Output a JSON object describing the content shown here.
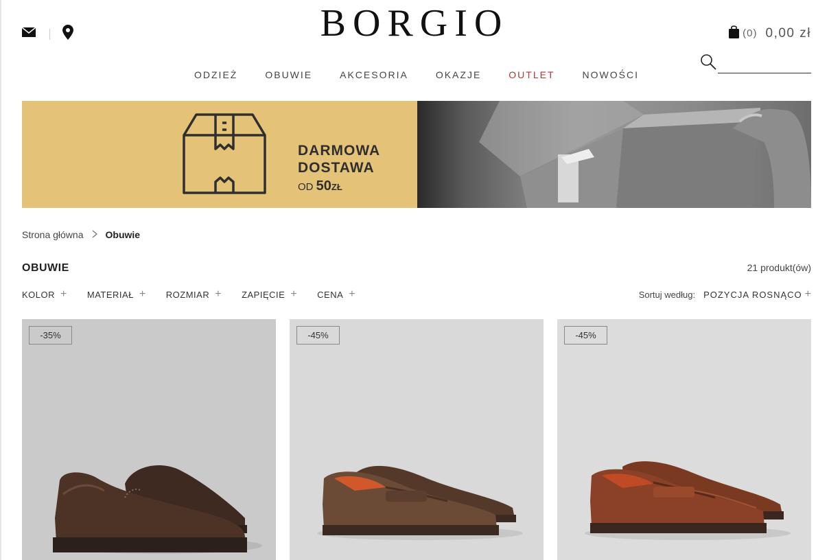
{
  "brand": {
    "logo": "BORGIO"
  },
  "header": {
    "cart_count": "(0)",
    "cart_total": "0,00 zł",
    "search_placeholder": ""
  },
  "nav": {
    "items": [
      {
        "label": "ODZIEŻ"
      },
      {
        "label": "OBUWIE"
      },
      {
        "label": "AKCESORIA"
      },
      {
        "label": "OKAZJE"
      },
      {
        "label": "OUTLET",
        "color": "#a83a32"
      },
      {
        "label": "NOWOŚCI"
      }
    ]
  },
  "banner": {
    "line1": "DARMOWA",
    "line2": "DOSTAWA",
    "od": "OD",
    "amount": "50",
    "currency": "ZŁ",
    "bg_color": "#e4c277"
  },
  "breadcrumb": {
    "home": "Strona główna",
    "current": "Obuwie"
  },
  "category": {
    "title": "OBUWIE",
    "count": "21 produkt(ów)"
  },
  "filters": [
    {
      "label": "KOLOR"
    },
    {
      "label": "MATERIAŁ"
    },
    {
      "label": "ROZMIAR"
    },
    {
      "label": "ZAPIĘCIE"
    },
    {
      "label": "CENA"
    }
  ],
  "sort": {
    "label": "Sortuj według:",
    "value": "POZYCJA ROSNĄCO"
  },
  "products": [
    {
      "badge": "-35%",
      "image": "brown-suede-brogue-shoes",
      "bg": "#cacaca"
    },
    {
      "badge": "-45%",
      "image": "brown-suede-penny-loafers",
      "bg": "#d9d9d9"
    },
    {
      "badge": "-45%",
      "image": "brown-leather-penny-loafers",
      "bg": "#dcdcdc"
    }
  ]
}
